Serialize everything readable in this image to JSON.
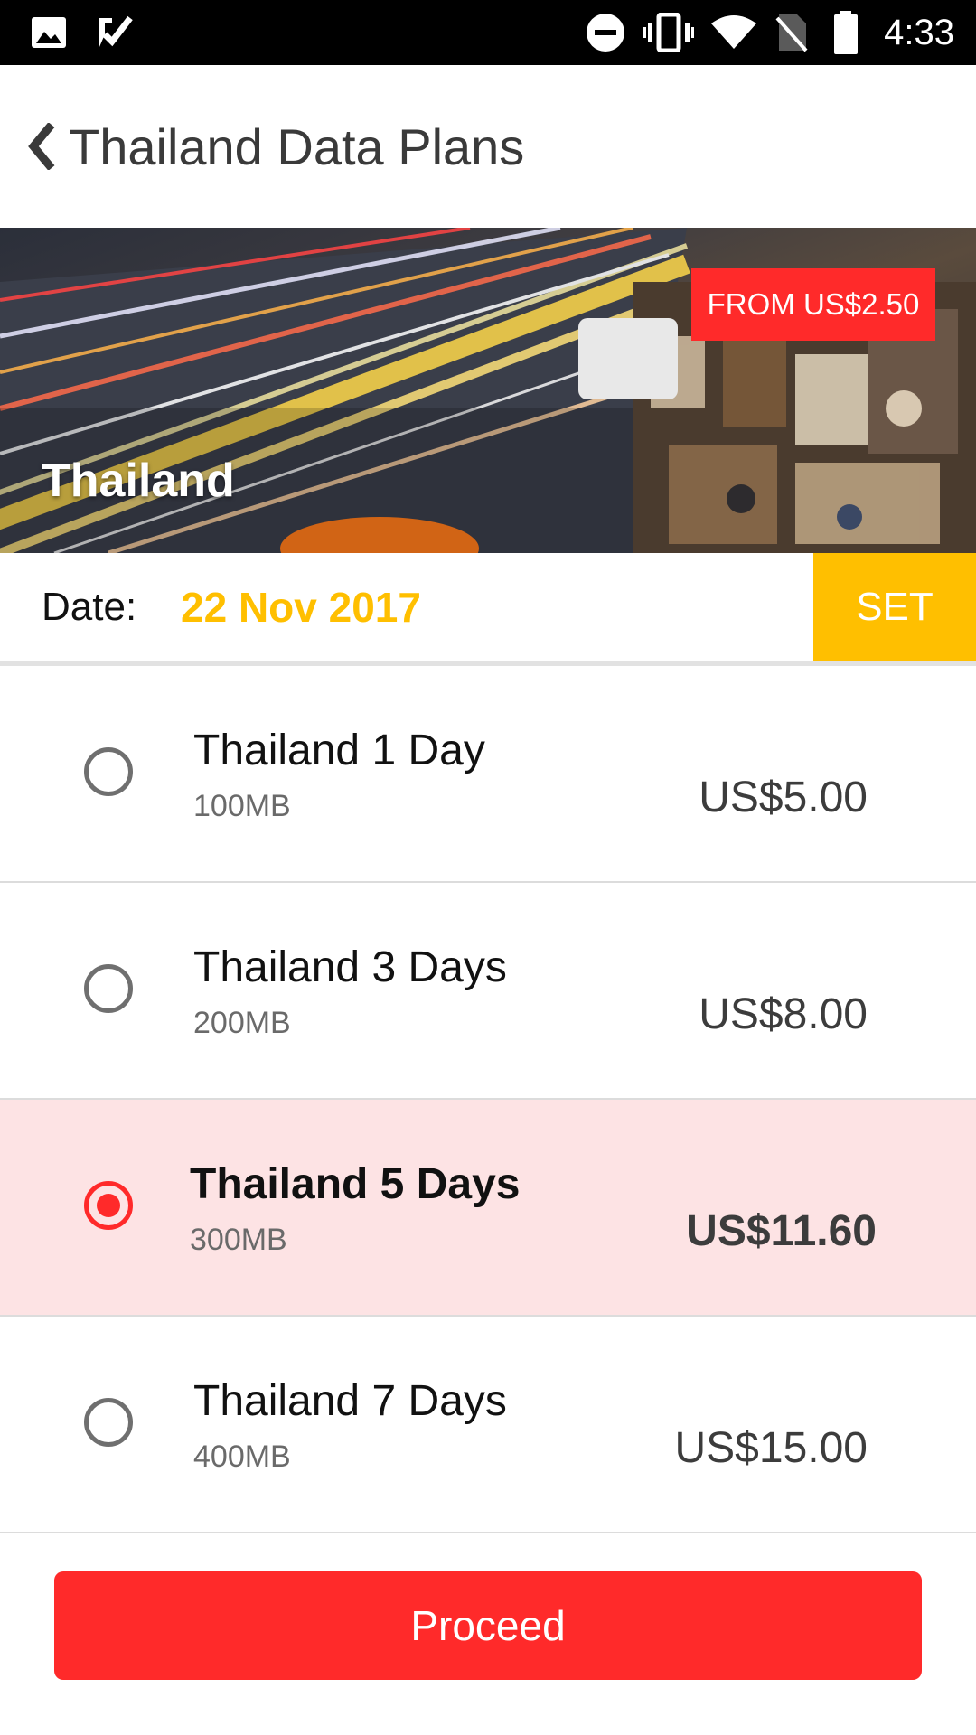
{
  "status_bar": {
    "time": "4:33",
    "icons": [
      "image-icon",
      "check-icon",
      "do-not-disturb-icon",
      "vibrate-icon",
      "wifi-icon",
      "no-sim-icon",
      "battery-icon"
    ]
  },
  "header": {
    "back_icon": "chevron-left-icon",
    "title": "Thailand Data Plans"
  },
  "hero": {
    "badge": "FROM US$2.50",
    "country": "Thailand"
  },
  "date_row": {
    "label": "Date:",
    "value": "22 Nov 2017",
    "set_label": "SET"
  },
  "plans": [
    {
      "name": "Thailand 1 Day",
      "data": "100MB",
      "price": "US$5.00",
      "selected": false
    },
    {
      "name": "Thailand 3 Days",
      "data": "200MB",
      "price": "US$8.00",
      "selected": false
    },
    {
      "name": "Thailand 5 Days",
      "data": "300MB",
      "price": "US$11.60",
      "selected": true
    },
    {
      "name": "Thailand 7 Days",
      "data": "400MB",
      "price": "US$15.00",
      "selected": false
    }
  ],
  "proceed_label": "Proceed",
  "colors": {
    "accent_red": "#ff2a2a",
    "accent_yellow": "#ffbf00",
    "selected_row_bg": "#fde3e4"
  }
}
